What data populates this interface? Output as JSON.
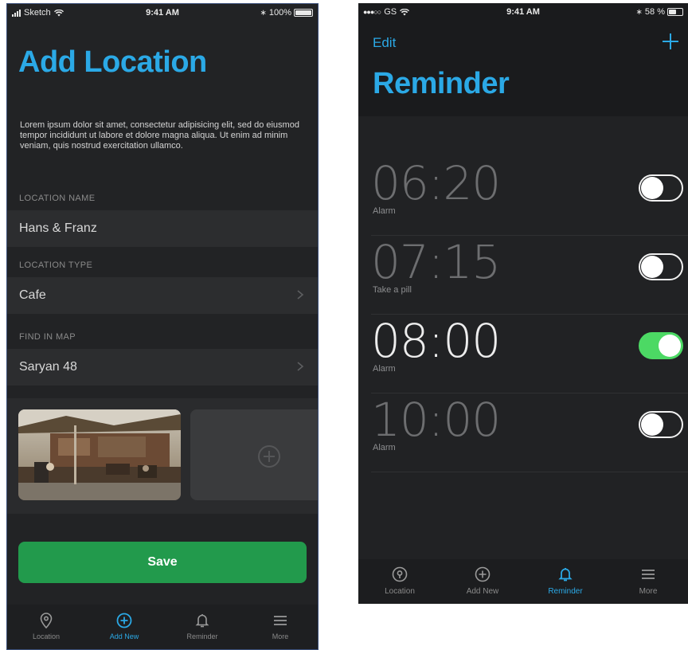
{
  "left": {
    "status": {
      "carrier": "Sketch",
      "time": "9:41 AM",
      "battery": "100%",
      "battery_level": 1.0
    },
    "title": "Add Location",
    "description": "Lorem ipsum dolor sit amet, consectetur adipisicing elit, sed do eiusmod tempor incididunt ut labore et dolore magna aliqua. Ut enim ad minim veniam, quis nostrud exercitation ullamco.",
    "fields": [
      {
        "label": "LOCATION NAME",
        "value": "Hans & Franz"
      },
      {
        "label": "LOCATION TYPE",
        "value": "Cafe"
      },
      {
        "label": "FIND IN MAP",
        "value": "Saryan 48"
      }
    ],
    "save_label": "Save",
    "tabs": [
      {
        "label": "Location",
        "icon": "location-pin-icon"
      },
      {
        "label": "Add New",
        "icon": "plus-circle-icon",
        "active": true
      },
      {
        "label": "Reminder",
        "icon": "bell-icon"
      },
      {
        "label": "More",
        "icon": "menu-icon"
      }
    ]
  },
  "right": {
    "status": {
      "carrier": "GS",
      "time": "9:41 AM",
      "battery": "58 %",
      "battery_level": 0.58
    },
    "edit_label": "Edit",
    "title": "Reminder",
    "alarms": [
      {
        "time": "06:20",
        "label": "Alarm",
        "enabled": false
      },
      {
        "time": "07:15",
        "label": "Take a pill",
        "enabled": false
      },
      {
        "time": "08:00",
        "label": "Alarm",
        "enabled": true
      },
      {
        "time": "10:00",
        "label": "Alarm",
        "enabled": false
      }
    ],
    "tabs": [
      {
        "label": "Location",
        "icon": "location-pin-icon"
      },
      {
        "label": "Add New",
        "icon": "plus-circle-icon"
      },
      {
        "label": "Reminder",
        "icon": "bell-icon",
        "active": true
      },
      {
        "label": "More",
        "icon": "menu-icon"
      }
    ]
  },
  "colors": {
    "accent": "#2ba9e6",
    "save": "#229a4c",
    "toggle_on": "#4cd964",
    "background": "#222325"
  }
}
